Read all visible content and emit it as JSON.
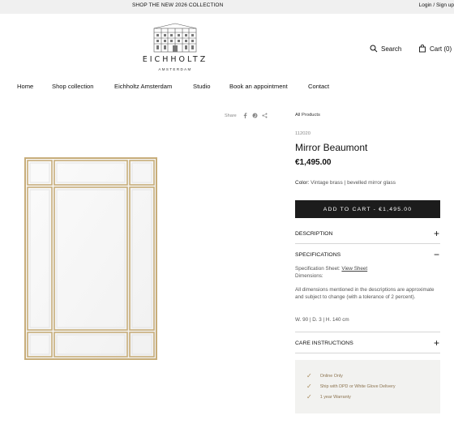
{
  "topbar": {
    "promo": "SHOP THE NEW 2026 COLLECTION",
    "login": "Login / Sign up"
  },
  "brand": {
    "name": "EICHHOLTZ",
    "city": "AMSTERDAM"
  },
  "header": {
    "search_label": "Search",
    "cart_label": "Cart (0)"
  },
  "nav": {
    "items": [
      "Home",
      "Shop collection",
      "Eichholtz Amsterdam",
      "Studio",
      "Book an appointment",
      "Contact"
    ]
  },
  "share": {
    "label": "Share",
    "icons": [
      "facebook-icon",
      "pinterest-icon",
      "share-icon"
    ]
  },
  "product": {
    "breadcrumb": "All Products",
    "sku": "112020",
    "title": "Mirror Beaumont",
    "price": "€1,495.00",
    "color_label": "Color:",
    "color_value": "Vintage brass | bevelled mirror glass",
    "add_to_cart": "ADD TO CART - €1,495.00"
  },
  "accordion": {
    "description": "DESCRIPTION",
    "specifications": "SPECIFICATIONS",
    "care": "CARE INSTRUCTIONS",
    "spec_sheet_label": "Specification Sheet:",
    "spec_sheet_link": "View Sheet",
    "dimensions_label": "Dimensions:",
    "note": "All dimensions mentioned in the descriptions are approximate and subject to change (with a tolerance of 2 percent).",
    "dimensions": "W. 90 | D. 3 | H. 140 cm"
  },
  "perks": [
    "Online Only",
    "Ship with DPD or White Glove Delivery",
    "1 year Warranty"
  ],
  "colors": {
    "brass": "#c7ad7a",
    "button": "#1c1c1c",
    "perk_text": "#8c7450"
  }
}
